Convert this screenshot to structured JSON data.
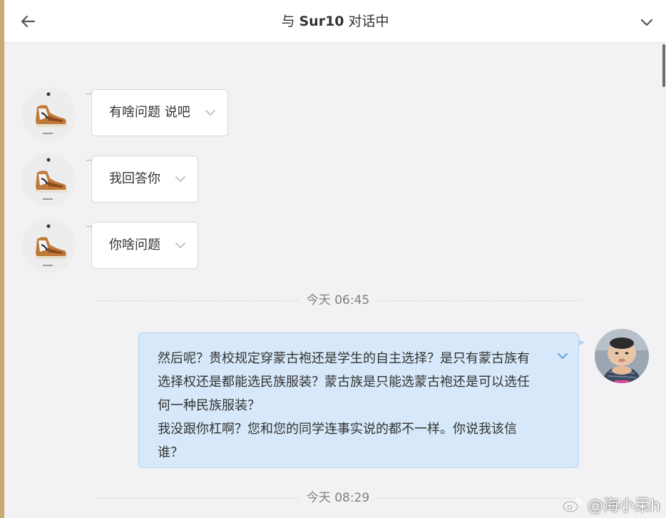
{
  "header": {
    "title_prefix": "与",
    "contact_name": "Sur10",
    "title_suffix": "对话中"
  },
  "messages_received": [
    {
      "text": "有啥问题 说吧"
    },
    {
      "text": "我回答你"
    },
    {
      "text": "你啥问题"
    }
  ],
  "time_separators": [
    "今天 06:45",
    "今天 08:29"
  ],
  "message_sent": {
    "lines": [
      "然后呢？贵校规定穿蒙古袍还是学生的自主选择？是只有蒙古族有",
      "选择权还是都能选民族服装？蒙古族是只能选蒙古袍还是可以选任",
      "何一种民族服装？",
      "我没跟你杠啊？您和您的同学连事实说的都不一样。你说我该信",
      "谁？"
    ]
  },
  "watermark": {
    "text": "@海小呆h"
  },
  "icons": {
    "back": "arrow-left-icon",
    "collapse": "chevron-down-icon",
    "message_menu": "chevron-down-icon",
    "weibo": "weibo-logo-icon"
  },
  "colors": {
    "header_bg": "#ffffff",
    "chat_bg": "#f2f2f4",
    "received_bubble": "#ffffff",
    "sent_bubble": "#d6e8f9",
    "sent_border": "#b9d4ef",
    "outer_bg": "#c8a874"
  }
}
